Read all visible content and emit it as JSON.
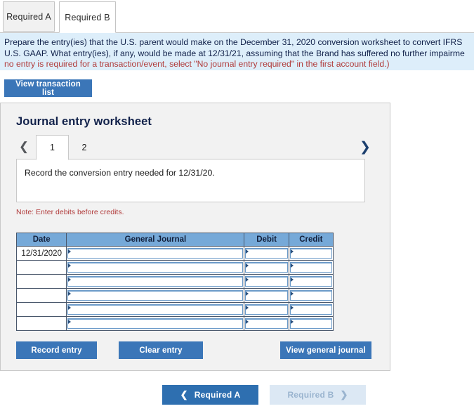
{
  "tabs": [
    {
      "label": "Required A",
      "active": false
    },
    {
      "label": "Required B",
      "active": true
    }
  ],
  "instruction": {
    "line1": "Prepare the entry(ies) that the U.S. parent would make on the December 31, 2020 conversion worksheet to convert IFRS",
    "line2": "U.S. GAAP. What entry(ies), if any, would be made at 12/31/21, assuming that the Brand has suffered no further impairme",
    "line3": "no entry is required for a transaction/event, select \"No journal entry required\" in the first account field.)"
  },
  "toolbar": {
    "view_transaction_list": "View transaction list"
  },
  "worksheet": {
    "title": "Journal entry worksheet",
    "pager": {
      "prev_icon": "chevron-left-icon",
      "next_icon": "chevron-right-icon",
      "pages": [
        {
          "label": "1",
          "selected": true
        },
        {
          "label": "2",
          "selected": false
        }
      ]
    },
    "prompt": "Record the conversion entry needed for 12/31/20.",
    "note": "Note: Enter debits before credits.",
    "table": {
      "columns": [
        "Date",
        "General Journal",
        "Debit",
        "Credit"
      ],
      "rows": [
        {
          "date": "12/31/2020",
          "general_journal": "",
          "debit": "",
          "credit": ""
        },
        {
          "date": "",
          "general_journal": "",
          "debit": "",
          "credit": ""
        },
        {
          "date": "",
          "general_journal": "",
          "debit": "",
          "credit": ""
        },
        {
          "date": "",
          "general_journal": "",
          "debit": "",
          "credit": ""
        },
        {
          "date": "",
          "general_journal": "",
          "debit": "",
          "credit": ""
        },
        {
          "date": "",
          "general_journal": "",
          "debit": "",
          "credit": ""
        }
      ]
    },
    "actions": {
      "record_entry": "Record entry",
      "clear_entry": "Clear entry",
      "view_general_journal": "View general journal"
    }
  },
  "bottom_nav": {
    "prev_label": "Required A",
    "prev_icon": "chevron-left-icon",
    "next_label": "Required B",
    "next_icon": "chevron-right-icon"
  },
  "colors": {
    "button_blue": "#3b76b8",
    "nav_blue": "#2e6fb0",
    "nav_disabled": "#dce8f4",
    "table_header_blue": "#76a9d8",
    "instruction_bg": "#ddeefa",
    "panel_bg": "#f2f2f2",
    "note_red": "#b03a3a",
    "title_navy": "#11214a"
  }
}
